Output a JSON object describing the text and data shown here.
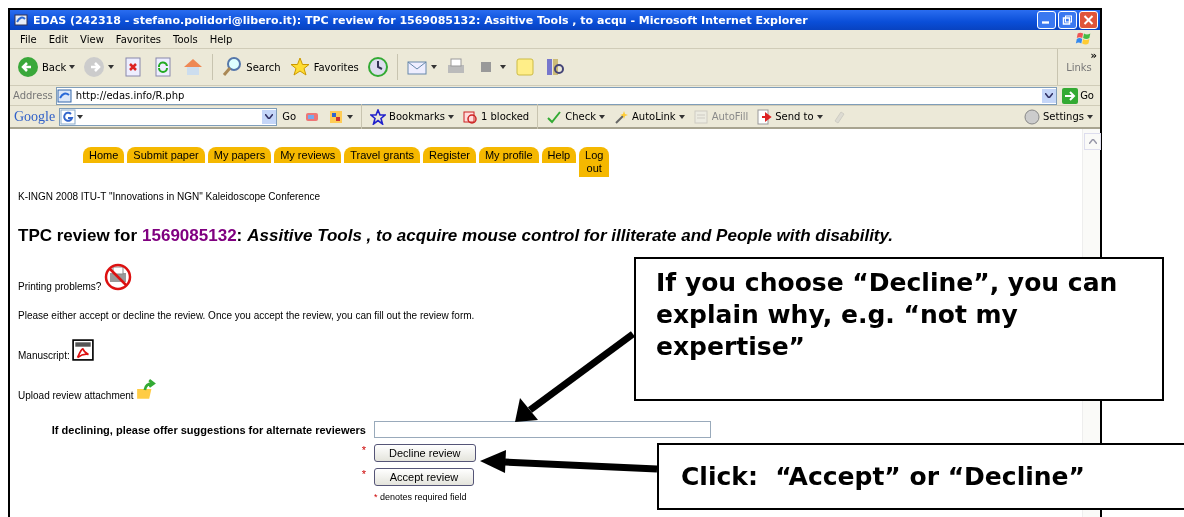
{
  "window": {
    "title": "EDAS (242318 - stefano.polidori@libero.it): TPC review for 1569085132: Assitive Tools , to acqu - Microsoft Internet Explorer"
  },
  "menu": [
    "File",
    "Edit",
    "View",
    "Favorites",
    "Tools",
    "Help"
  ],
  "toolbar": [
    {
      "kind": "back",
      "label": "Back",
      "dropdown": true
    },
    {
      "kind": "forward",
      "dropdown": true
    },
    {
      "kind": "stop",
      "dropdown": false
    },
    {
      "kind": "refresh",
      "dropdown": false
    },
    {
      "kind": "home",
      "dropdown": false
    },
    {
      "kind": "search",
      "label": "Search",
      "dropdown": false
    },
    {
      "kind": "favorites",
      "label": "Favorites",
      "dropdown": false
    },
    {
      "kind": "history",
      "dropdown": false
    },
    {
      "kind": "mail",
      "dropdown": true
    },
    {
      "kind": "print",
      "dropdown": false
    },
    {
      "kind": "edit",
      "dropdown": true
    },
    {
      "kind": "note",
      "dropdown": false
    },
    {
      "kind": "research",
      "dropdown": false
    }
  ],
  "links": {
    "label": "Links",
    "more": "»"
  },
  "address": {
    "label": "Address",
    "value": "http://edas.info/R.php",
    "go": "Go"
  },
  "google_bar": {
    "logo": "Google",
    "items": [
      {
        "kind": "go",
        "label": "Go",
        "dropdown": false,
        "disabled": false
      },
      {
        "kind": "pagerank",
        "dropdown": false,
        "disabled": false
      },
      {
        "kind": "popup",
        "dropdown": true,
        "disabled": false
      },
      {
        "kind": "bookmarks",
        "label": "Bookmarks",
        "dropdown": true,
        "disabled": false
      },
      {
        "kind": "blocked",
        "label": "1 blocked",
        "dropdown": false,
        "disabled": false
      },
      {
        "kind": "check",
        "label": "Check",
        "dropdown": true,
        "disabled": false
      },
      {
        "kind": "autolink",
        "label": "AutoLink",
        "dropdown": true,
        "disabled": false
      },
      {
        "kind": "autofill",
        "label": "AutoFill",
        "dropdown": false,
        "disabled": true
      },
      {
        "kind": "sendto",
        "label": "Send to",
        "dropdown": true,
        "disabled": false
      },
      {
        "kind": "eraser",
        "dropdown": false,
        "disabled": true
      }
    ],
    "settings": "Settings"
  },
  "nav_tabs": [
    "Home",
    "Submit paper",
    "My papers",
    "My reviews",
    "Travel grants",
    "Register",
    "My profile",
    "Help",
    "Log out"
  ],
  "conference": "K-INGN 2008 ITU-T \"Innovations in NGN\" Kaleidoscope Conference",
  "heading": {
    "prefix": "TPC review for",
    "paper_id": "1569085132",
    "separator": ":",
    "title": "Assitive Tools , to acquire mouse control for illiterate and People with disability."
  },
  "printing": "Printing problems?",
  "instructions": "Please either accept or decline the review. Once you accept the review, you can fill out the review form.",
  "manuscript": "Manuscript:",
  "upload": "Upload review attachment",
  "form": {
    "label": "If declining, please offer suggestions for alternate reviewers",
    "buttons": [
      {
        "label": "Decline review",
        "required_mark": "*"
      },
      {
        "label": "Accept review",
        "required_mark": "*"
      }
    ],
    "note_mark": "*",
    "note": "denotes required field"
  },
  "callouts": [
    {
      "text": "If you choose “Decline”, you can explain why, e.g. “not my expertise”"
    },
    {
      "text": "Click:  “Accept” or “Decline”"
    }
  ]
}
